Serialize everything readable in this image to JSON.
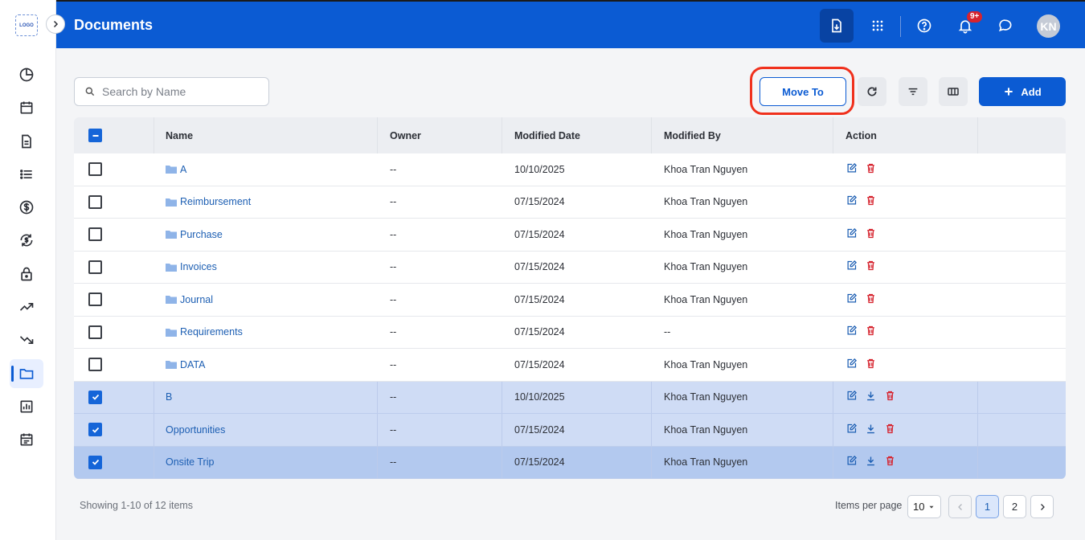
{
  "app": {
    "logo_text": "LOGO",
    "page_title": "Documents"
  },
  "header": {
    "notification_badge": "9+",
    "avatar_initials": "KN",
    "icons": [
      "download-doc-icon",
      "apps-grid-icon",
      "help-icon",
      "bell-icon",
      "chat-icon"
    ]
  },
  "sidebar": {
    "icons": [
      "pie-chart-icon",
      "calendar-icon",
      "document-icon",
      "list-icon",
      "dollar-icon",
      "currency-exchange-icon",
      "lock-icon",
      "trending-up-icon",
      "trending-down-icon",
      "folder-icon",
      "report-chart-icon",
      "event-note-icon"
    ],
    "active_index": 9
  },
  "toolbar": {
    "search_placeholder": "Search by Name",
    "move_to_label": "Move To",
    "add_label": "Add"
  },
  "table": {
    "columns": [
      "Name",
      "Owner",
      "Modified Date",
      "Modified By",
      "Action"
    ],
    "rows": [
      {
        "name": "A",
        "folder": true,
        "owner": "--",
        "date": "10/10/2025",
        "by": "Khoa Tran Nguyen",
        "checked": false
      },
      {
        "name": "Reimbursement",
        "folder": true,
        "owner": "--",
        "date": "07/15/2024",
        "by": "Khoa Tran Nguyen",
        "checked": false
      },
      {
        "name": "Purchase",
        "folder": true,
        "owner": "--",
        "date": "07/15/2024",
        "by": "Khoa Tran Nguyen",
        "checked": false
      },
      {
        "name": "Invoices",
        "folder": true,
        "owner": "--",
        "date": "07/15/2024",
        "by": "Khoa Tran Nguyen",
        "checked": false
      },
      {
        "name": "Journal",
        "folder": true,
        "owner": "--",
        "date": "07/15/2024",
        "by": "Khoa Tran Nguyen",
        "checked": false
      },
      {
        "name": "Requirements",
        "folder": true,
        "owner": "--",
        "date": "07/15/2024",
        "by": "--",
        "checked": false
      },
      {
        "name": "DATA",
        "folder": true,
        "owner": "--",
        "date": "07/15/2024",
        "by": "Khoa Tran Nguyen",
        "checked": false
      },
      {
        "name": "B",
        "folder": false,
        "owner": "--",
        "date": "10/10/2025",
        "by": "Khoa Tran Nguyen",
        "checked": true
      },
      {
        "name": "Opportunities",
        "folder": false,
        "owner": "--",
        "date": "07/15/2024",
        "by": "Khoa Tran Nguyen",
        "checked": true
      },
      {
        "name": "Onsite Trip",
        "folder": false,
        "owner": "--",
        "date": "07/15/2024",
        "by": "Khoa Tran Nguyen",
        "checked": true
      }
    ]
  },
  "footer": {
    "showing_text": "Showing 1-10 of 12 items",
    "items_per_page_label": "Items per page",
    "items_per_page_value": "10",
    "pages": [
      "1",
      "2"
    ],
    "current_page": "1"
  },
  "colors": {
    "primary": "#0b5bd3",
    "danger": "#d6232e",
    "highlight_ring": "#f0311d"
  }
}
